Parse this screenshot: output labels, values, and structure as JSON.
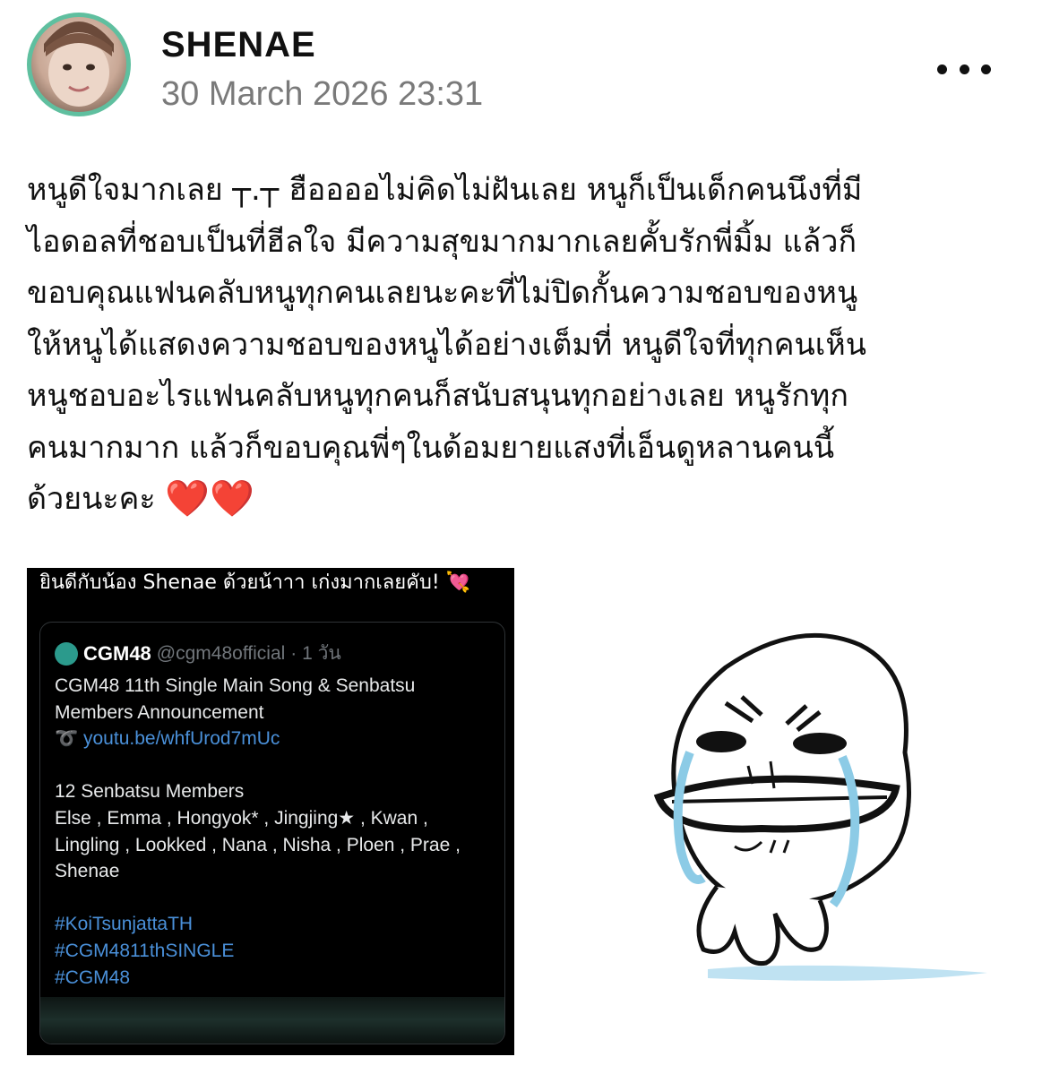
{
  "post": {
    "author_name": "SHENAE",
    "timestamp": "30 March 2026 23:31",
    "text_lines": [
      "หนูดีใจมากเลย ┬.┬ ฮืออออไม่คิดไม่ฝันเลย หนูก็เป็นเด็กคนนึงที่มี",
      "ไอดอลที่ชอบเป็นที่ฮีลใจ มีความสุขมากมากเลยคั้บรักพี่มิ้ม แล้วก็",
      "ขอบคุณแฟนคลับหนูทุกคนเลยนะคะที่ไม่ปิดกั้นความชอบของหนู",
      "ให้หนูได้แสดงความชอบของหนูได้อย่างเต็มที่ หนูดีใจที่ทุกคนเห็น",
      "หนูชอบอะไรแฟนคลับหนูทุกคนก็สนับสนุนทุกอย่างเลย หนูรักทุก",
      "คนมากมาก แล้วก็ขอบคุณพี่ๆในด้อมยายแสงที่เอ็นดูหลานคนนี้",
      "ด้วยนะคะ"
    ],
    "hearts": "❤️❤️"
  },
  "embed": {
    "caption": "ยินดีกับน้อง Shenae ด้วยน้าาา เก่งมากเลยคับ! 💘",
    "quote": {
      "name": "CGM48",
      "handle": "@cgm48official",
      "time": "· 1 วัน",
      "lines": [
        "CGM48 11th Single Main Song & Senbatsu",
        "Members Announcement"
      ],
      "link_prefix": "➰",
      "link": "youtu.be/whfUrod7mUc",
      "members_title": "12 Senbatsu Members",
      "members_lines": [
        "Else , Emma , Hongyok* , Jingjing★ , Kwan ,",
        "Lingling , Lookked , Nana , Nisha , Ploen , Prae ,",
        "Shenae"
      ],
      "hashtags": [
        "#KoiTsunjattaTH",
        "#CGM4811thSINGLE",
        "#CGM48"
      ]
    }
  }
}
